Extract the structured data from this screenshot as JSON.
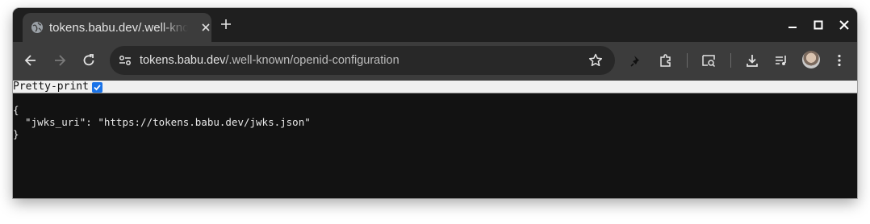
{
  "tab": {
    "title": "tokens.babu.dev/.well-known/openid-configuration",
    "favicon": "globe-icon"
  },
  "omnibox": {
    "host": "tokens.babu.dev",
    "path": "/.well-known/openid-configuration"
  },
  "pretty_print": {
    "label": "Pretty-print",
    "checked": true
  },
  "json_view": {
    "open_brace": "{",
    "line": "  \"jwks_uri\": \"https://tokens.babu.dev/jwks.json\"",
    "close_brace": "}"
  },
  "colors": {
    "frame": "#1f1f1f",
    "toolbar": "#3c3c3c",
    "content_bg": "#121212",
    "checkbox_accent": "#1a73e8"
  }
}
